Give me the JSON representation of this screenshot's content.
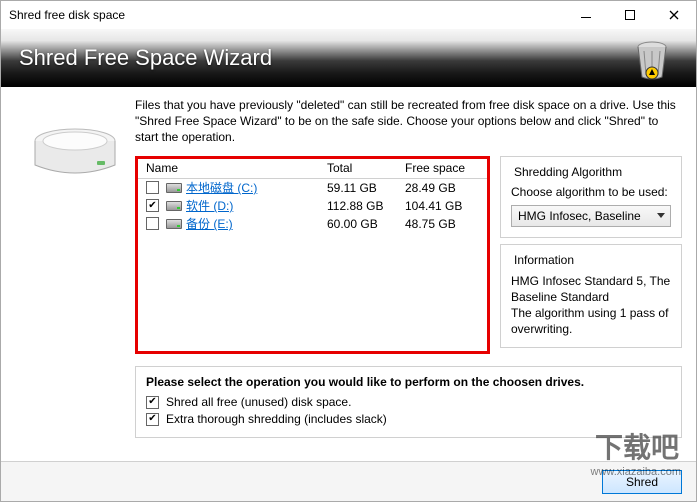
{
  "window": {
    "title": "Shred free disk space"
  },
  "banner": {
    "heading": "Shred Free Space Wizard"
  },
  "description": "Files that you have previously \"deleted\" can still be recreated from free disk space on a drive. Use this \"Shred Free Space Wizard\" to be on the safe side. Choose your options below and click \"Shred\" to start the operation.",
  "table": {
    "headers": {
      "name": "Name",
      "total": "Total",
      "free": "Free space"
    },
    "rows": [
      {
        "checked": false,
        "label": "本地磁盘 (C:)",
        "total": "59.11 GB",
        "free": "28.49 GB"
      },
      {
        "checked": true,
        "label": "软件 (D:)",
        "total": "112.88 GB",
        "free": "104.41 GB"
      },
      {
        "checked": false,
        "label": "备份 (E:)",
        "total": "60.00 GB",
        "free": "48.75 GB"
      }
    ]
  },
  "algorithm": {
    "group_label": "Shredding Algorithm",
    "hint": "Choose algorithm to be used:",
    "selected": "HMG Infosec, Baseline",
    "info_label": "Information",
    "info_text": "HMG Infosec Standard 5, The Baseline Standard\nThe algorithm using 1 pass of overwriting."
  },
  "operations": {
    "prompt": "Please select the operation you would like to perform on the choosen drives.",
    "opt1": {
      "checked": true,
      "label": "Shred all free (unused) disk space."
    },
    "opt2": {
      "checked": true,
      "label": "Extra thorough shredding (includes slack)"
    }
  },
  "footer": {
    "shred_label": "Shred"
  },
  "watermark": {
    "brand": "下载吧",
    "url": "www.xiazaiba.com"
  }
}
